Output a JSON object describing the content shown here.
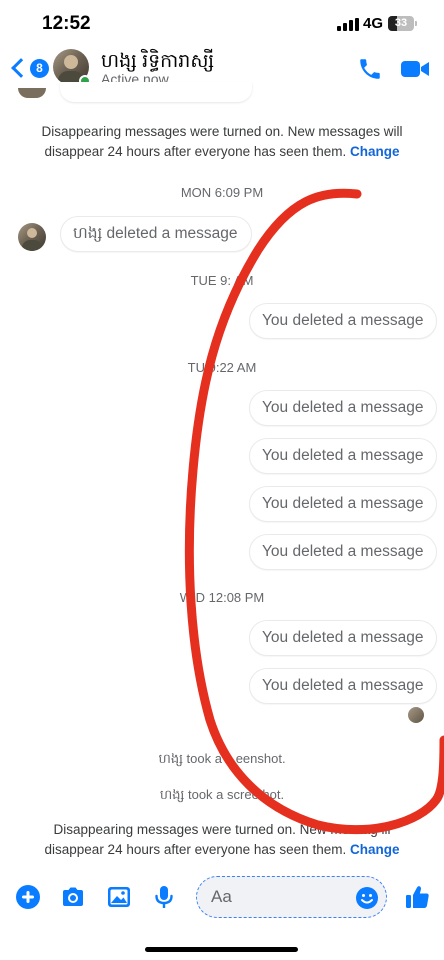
{
  "status_bar": {
    "time": "12:52",
    "network": "4G",
    "battery": "33",
    "battery_level": 0.33
  },
  "header": {
    "unread_count": "8",
    "contact_name": "ហង្ស រិទ្ធិការាស្សី",
    "contact_status": "Active now",
    "accent_color": "#0a7cff"
  },
  "chat": {
    "disappearing_notice_top": {
      "line1": "Disappearing messages were turned on. New messages will",
      "line2": "disappear 24 hours after everyone has seen them.",
      "change_label": "Change"
    },
    "groups": [
      {
        "timestamp": "MON 6:09 PM",
        "messages": [
          {
            "direction": "incoming",
            "text": "ហង្ស deleted a message"
          }
        ]
      },
      {
        "timestamp": "TUE 9:   AM",
        "messages": [
          {
            "direction": "outgoing",
            "text": "You deleted a message"
          }
        ]
      },
      {
        "timestamp": "TU    9:22 AM",
        "messages": [
          {
            "direction": "outgoing",
            "text": "You deleted a message"
          },
          {
            "direction": "outgoing",
            "text": "You deleted a message"
          },
          {
            "direction": "outgoing",
            "text": "You deleted a message"
          },
          {
            "direction": "outgoing",
            "text": "You deleted a message"
          }
        ]
      },
      {
        "timestamp": "W   D 12:08 PM",
        "messages": [
          {
            "direction": "outgoing",
            "text": "You deleted a message"
          },
          {
            "direction": "outgoing",
            "text": "You deleted a message"
          }
        ]
      }
    ],
    "screenshot_notices": [
      "ហង្ស took a s    eenshot.",
      "ហង្ស took a scree   hot."
    ],
    "disappearing_notice_bottom": {
      "line1": "Disappearing messages were turned on. New messag    ill",
      "line2": "disappear 24 hours after everyone has seen them.",
      "change_label": "Change"
    }
  },
  "composer": {
    "placeholder": "Aa",
    "icons": [
      "plus-icon",
      "camera-icon",
      "gallery-icon",
      "microphone-icon",
      "emoji-icon",
      "thumbs-up-icon"
    ]
  },
  "annotation": {
    "color": "#e5301f"
  }
}
